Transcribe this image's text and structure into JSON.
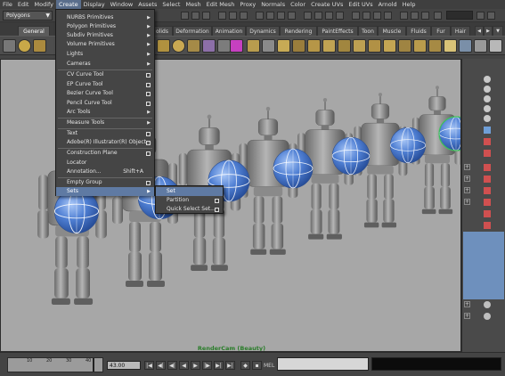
{
  "menubar": [
    "File",
    "Edit",
    "Modify",
    "Create",
    "Display",
    "Window",
    "Assets",
    "Select",
    "Mesh",
    "Edit Mesh",
    "Proxy",
    "Normals",
    "Color",
    "Create UVs",
    "Edit UVs",
    "Arnold",
    "Help"
  ],
  "status": {
    "mode": "Polygons"
  },
  "shelf_tabs": [
    "General",
    "olids",
    "Deformation",
    "Animation",
    "Dynamics",
    "Rendering",
    "PaintEffects",
    "Toon",
    "Muscle",
    "Fluids",
    "Fur",
    "Hair"
  ],
  "create_menu": {
    "items": [
      {
        "label": "NURBS Primitives",
        "submenu": true
      },
      {
        "label": "Polygon Primitives",
        "submenu": true
      },
      {
        "label": "Subdiv Primitives",
        "submenu": true
      },
      {
        "label": "Volume Primitives",
        "submenu": true
      },
      {
        "label": "Lights",
        "submenu": true
      },
      {
        "label": "Cameras",
        "submenu": true
      },
      {
        "label": "CV Curve Tool",
        "option": true
      },
      {
        "label": "EP Curve Tool",
        "option": true
      },
      {
        "label": "Bezier Curve Tool",
        "option": true
      },
      {
        "label": "Pencil Curve Tool",
        "option": true
      },
      {
        "label": "Arc Tools",
        "submenu": true
      },
      {
        "label": "Measure Tools",
        "submenu": true
      },
      {
        "label": "Text",
        "option": true
      },
      {
        "label": "Adobe(R) Illustrator(R) Object...",
        "option": true
      },
      {
        "label": "Construction Plane",
        "option": true
      },
      {
        "label": "Locator"
      },
      {
        "label": "Annotation...",
        "shortcut": "Shift+A"
      },
      {
        "label": "Empty Group",
        "option": true
      },
      {
        "label": "Sets",
        "submenu": true,
        "highlighted": true
      }
    ]
  },
  "sets_submenu": {
    "items": [
      {
        "label": "Set",
        "highlighted": true
      },
      {
        "label": "Partition",
        "option": true
      },
      {
        "label": "Quick Select Set...",
        "option": true
      }
    ]
  },
  "viewport": {
    "label": "RenderCam (Beauty)"
  },
  "timeline": {
    "ticks": [
      "10",
      "20",
      "30",
      "40"
    ],
    "current_time": "43.00",
    "command_lang": "MEL"
  },
  "colors": {
    "menu_highlight": "#5f7aa3",
    "viewport_bg": "#a7a7a7",
    "sphere_blue": "#4f7fd3",
    "robot_gray": "#8a8a8a",
    "viewport_label_green": "#2a7d2a"
  }
}
